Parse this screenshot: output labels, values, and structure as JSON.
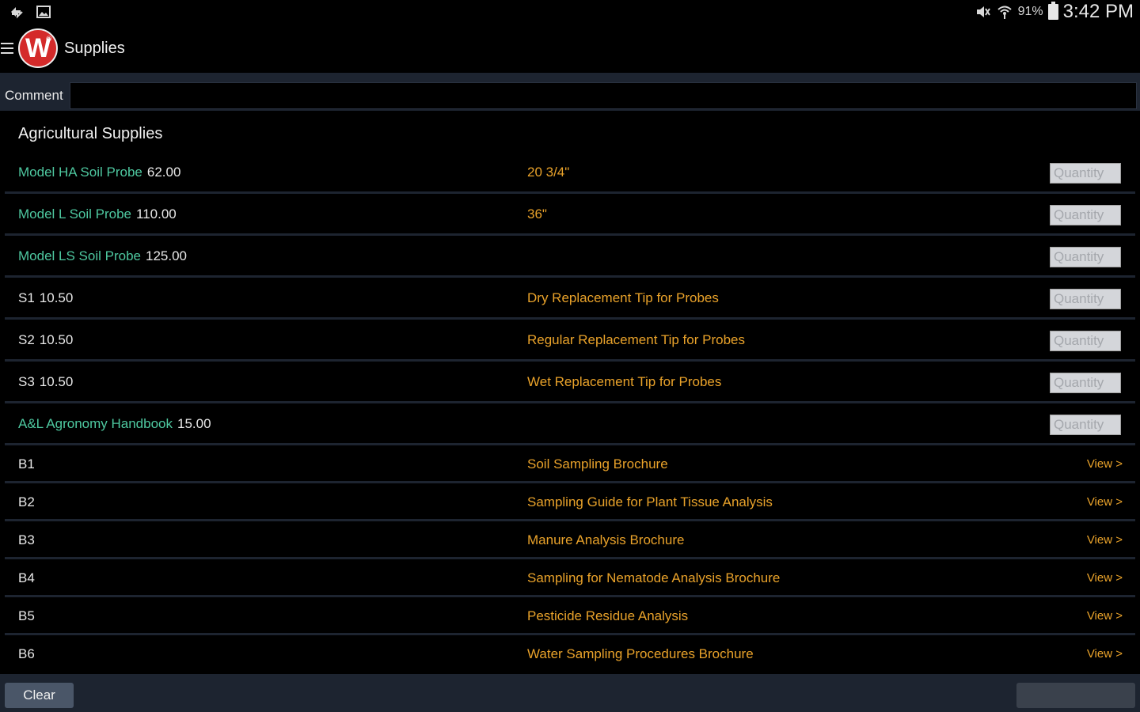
{
  "status_bar": {
    "battery": "91%",
    "time": "3:42 PM"
  },
  "app_bar": {
    "logo_letter": "W",
    "logo_mark": "®",
    "title": "Supplies"
  },
  "comment": {
    "label": "Comment",
    "value": ""
  },
  "section_title": "Agricultural Supplies",
  "quantity_placeholder": "Quantity",
  "products": [
    {
      "name": "Model HA Soil Probe",
      "price": "62.00",
      "desc": "20 3/4\""
    },
    {
      "name": "Model L Soil Probe",
      "price": "110.00",
      "desc": "36\""
    },
    {
      "name": "Model LS Soil Probe",
      "price": "125.00",
      "desc": ""
    },
    {
      "name": "S1",
      "price": "10.50",
      "desc": "Dry Replacement Tip for Probes"
    },
    {
      "name": "S2",
      "price": "10.50",
      "desc": "Regular Replacement Tip for Probes"
    },
    {
      "name": "S3",
      "price": "10.50",
      "desc": "Wet Replacement Tip for Probes"
    },
    {
      "name": "A&L Agronomy Handbook",
      "price": "15.00",
      "desc": ""
    }
  ],
  "brochures": [
    {
      "code": "B1",
      "title": "Soil Sampling Brochure",
      "link": "View >"
    },
    {
      "code": "B2",
      "title": "Sampling Guide for Plant Tissue Analysis",
      "link": "View >"
    },
    {
      "code": "B3",
      "title": "Manure Analysis Brochure",
      "link": "View >"
    },
    {
      "code": "B4",
      "title": "Sampling for Nematode Analysis Brochure",
      "link": "View >"
    },
    {
      "code": "B5",
      "title": "Pesticide Residue Analysis",
      "link": "View >"
    },
    {
      "code": "B6",
      "title": "Water Sampling Procedures Brochure",
      "link": "View >"
    }
  ],
  "footer": {
    "clear_label": "Clear"
  },
  "colors": {
    "accent_orange": "#e9a22a",
    "accent_green": "#4ec8a0",
    "bar_bg": "#1d2430",
    "logo_red": "#d42a2a"
  }
}
